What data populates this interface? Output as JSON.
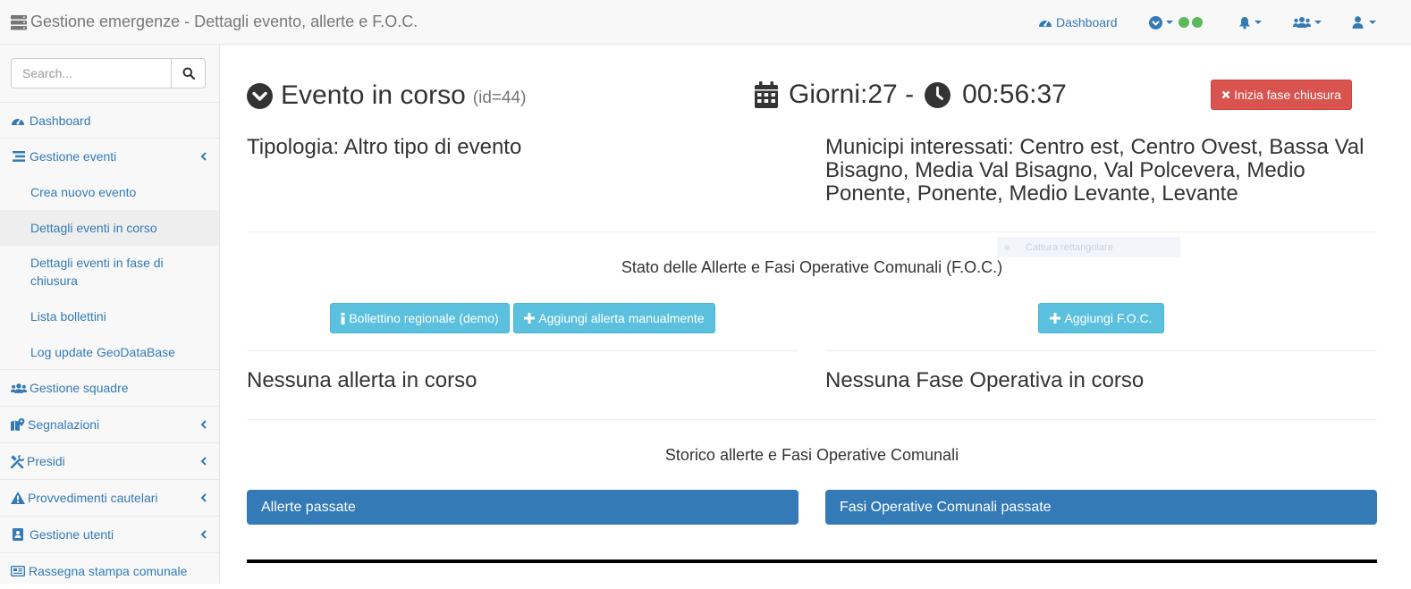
{
  "header": {
    "title": "Gestione emergenze - Dettagli evento, allerte e F.O.C.",
    "dashboard_label": "Dashboard",
    "accent": "#337ab7",
    "status_dots": [
      "#5cb85c",
      "#5cb85c"
    ]
  },
  "sidebar": {
    "search_placeholder": "Search...",
    "items": [
      {
        "label": "Dashboard",
        "icon": "dashboard-icon"
      },
      {
        "label": "Gestione eventi",
        "icon": "list-icon"
      },
      {
        "label": "Gestione squadre",
        "icon": "users-icon"
      },
      {
        "label": "Segnalazioni",
        "icon": "map-marker-icon"
      },
      {
        "label": "Presidi",
        "icon": "tools-icon"
      },
      {
        "label": "Provvedimenti cautelari",
        "icon": "warning-icon"
      },
      {
        "label": "Gestione utenti",
        "icon": "address-book-icon"
      },
      {
        "label": "Rassegna stampa comunale",
        "icon": "newspaper-icon"
      }
    ],
    "subitems": [
      {
        "label": "Crea nuovo evento"
      },
      {
        "label": "Dettagli eventi in corso"
      },
      {
        "label": "Dettagli eventi in fase di chiusura"
      },
      {
        "label": "Lista bollettini"
      },
      {
        "label": "Log update GeoDataBase"
      }
    ]
  },
  "main": {
    "event_title": "Evento in corso",
    "event_id": "(id=44)",
    "days_label": "Giorni:27 -",
    "time": "00:56:37",
    "close_button": "Inizia fase chiusura",
    "tipologia": "Tipologia: Altro tipo di evento",
    "municipi": "Municipi interessati: Centro est, Centro Ovest, Bassa Val Bisagno, Media Val Bisagno, Val Polcevera, Medio Ponente, Ponente, Medio Levante, Levante",
    "stato_title": "Stato delle Allerte e Fasi Operative Comunali (F.O.C.)",
    "ghost_text": "Cattura rettangolare",
    "btn_bollettino": "Bollettino regionale (demo)",
    "btn_aggiungi_allerta": "Aggiungi allerta manualmente",
    "btn_aggiungi_foc": "Aggiungi F.O.C.",
    "no_allerta": "Nessuna allerta in corso",
    "no_fase": "Nessuna Fase Operativa in corso",
    "storico_title": "Storico allerte e Fasi Operative Comunali",
    "panel_allerte": "Allerte passate",
    "panel_fasi": "Fasi Operative Comunali passate"
  }
}
